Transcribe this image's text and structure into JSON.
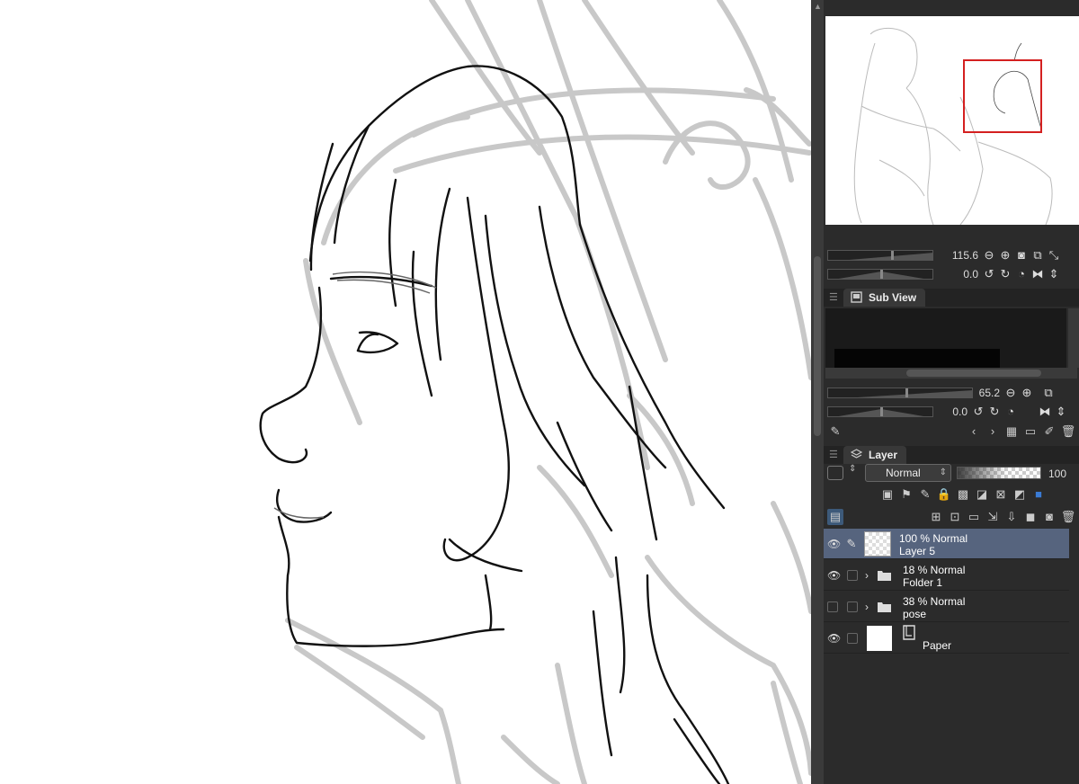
{
  "navigator": {
    "zoom_value": "115.6",
    "rotate_value": "0.0"
  },
  "subview": {
    "title": "Sub View",
    "zoom_value": "65.2",
    "rotate_value": "0.0"
  },
  "layer_panel": {
    "title": "Layer",
    "blend_mode": "Normal",
    "opacity": "100",
    "layers": [
      {
        "mode": "100 %  Normal",
        "name": "Layer 5",
        "type": "raster",
        "visible": true,
        "selected": true
      },
      {
        "mode": "18 %  Normal",
        "name": "Folder 1",
        "type": "folder",
        "visible": true,
        "selected": false
      },
      {
        "mode": "38 %  Normal",
        "name": "pose",
        "type": "folder",
        "visible": false,
        "selected": false
      },
      {
        "mode": "",
        "name": "Paper",
        "type": "paper",
        "visible": true,
        "selected": false
      }
    ]
  },
  "colors": {
    "selected_layer": "#56647e",
    "panel_bg": "#2b2b2b",
    "navigator_frame": "#d42020"
  },
  "icons": [
    "eye-icon",
    "pen-icon",
    "folder-icon",
    "paper-icon",
    "zoom-out-icon",
    "zoom-in-icon",
    "rotate-left-icon",
    "rotate-right-icon",
    "flip-icon",
    "eyedropper-icon",
    "trash-icon",
    "new-layer-icon"
  ]
}
